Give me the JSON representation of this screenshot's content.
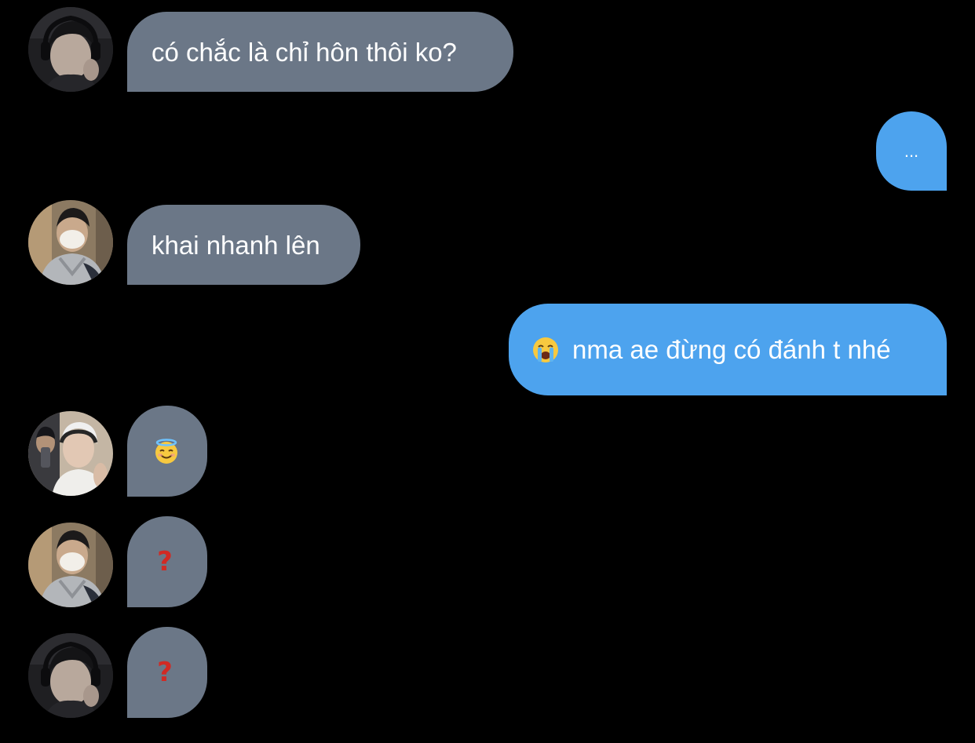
{
  "colors": {
    "background": "#000000",
    "incoming_bubble": "#6b7787",
    "outgoing_bubble": "#4da3ee",
    "text": "#ffffff",
    "question_mark": "#d12a24"
  },
  "messages": [
    {
      "direction": "incoming",
      "avatar": "avatar-headphones",
      "text": "có chắc là chỉ hôn thôi ko?"
    },
    {
      "direction": "outgoing",
      "text": "..."
    },
    {
      "direction": "incoming",
      "avatar": "avatar-cream-face",
      "text": "khai nhanh lên"
    },
    {
      "direction": "outgoing",
      "emoji": "loudly-crying-face-icon",
      "text": "nma ae đừng có đánh t nhé"
    },
    {
      "direction": "incoming",
      "avatar": "avatar-mirror-selfie",
      "emoji": "smiling-face-with-halo-icon"
    },
    {
      "direction": "incoming",
      "avatar": "avatar-cream-face",
      "text": "?",
      "emoji": "red-question-mark-icon"
    },
    {
      "direction": "incoming",
      "avatar": "avatar-headphones",
      "text": "?",
      "emoji": "red-question-mark-icon"
    }
  ]
}
